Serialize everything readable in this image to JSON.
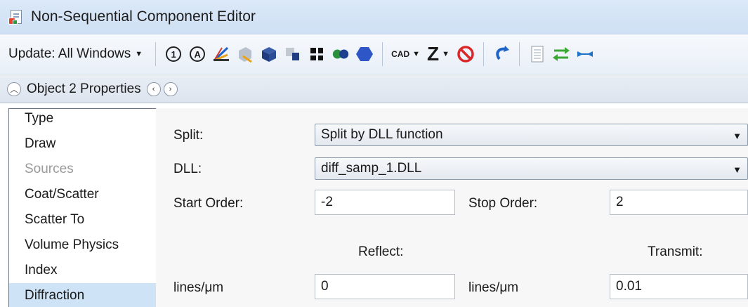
{
  "window": {
    "title": "Non-Sequential Component Editor"
  },
  "toolbar": {
    "update_label": "Update: All Windows",
    "cad_label": "CAD",
    "z_label": "Z",
    "icons": [
      "reset-1-icon",
      "reset-a-icon",
      "ray-trace-icon",
      "solid-view-icon",
      "cube-blue-icon",
      "cube-gray-icon",
      "grid-black-icon",
      "circles-icon",
      "hexagon-blue-icon",
      "no-entry-icon",
      "undo-arrow-icon",
      "document-icon",
      "swap-arrows-icon",
      "merge-arrows-icon"
    ]
  },
  "properties": {
    "title": "Object 2 Properties"
  },
  "categories": [
    {
      "label": "Type",
      "state": "normal"
    },
    {
      "label": "Draw",
      "state": "normal"
    },
    {
      "label": "Sources",
      "state": "disabled"
    },
    {
      "label": "Coat/Scatter",
      "state": "normal"
    },
    {
      "label": "Scatter To",
      "state": "normal"
    },
    {
      "label": "Volume Physics",
      "state": "normal"
    },
    {
      "label": "Index",
      "state": "normal"
    },
    {
      "label": "Diffraction",
      "state": "selected"
    }
  ],
  "form": {
    "split_label": "Split:",
    "split_value": "Split by DLL function",
    "dll_label": "DLL:",
    "dll_value": "diff_samp_1.DLL",
    "start_order_label": "Start Order:",
    "start_order_value": "-2",
    "stop_order_label": "Stop Order:",
    "stop_order_value": "2",
    "reflect_header": "Reflect:",
    "transmit_header": "Transmit:",
    "reflect_lines_label": "lines/μm",
    "reflect_lines_value": "0",
    "transmit_lines_label": "lines/μm",
    "transmit_lines_value": "0.01"
  },
  "colors": {
    "titlebar": "#cfe0f4",
    "selected": "#cfe3f7",
    "accent_blue": "#1e63c8"
  }
}
